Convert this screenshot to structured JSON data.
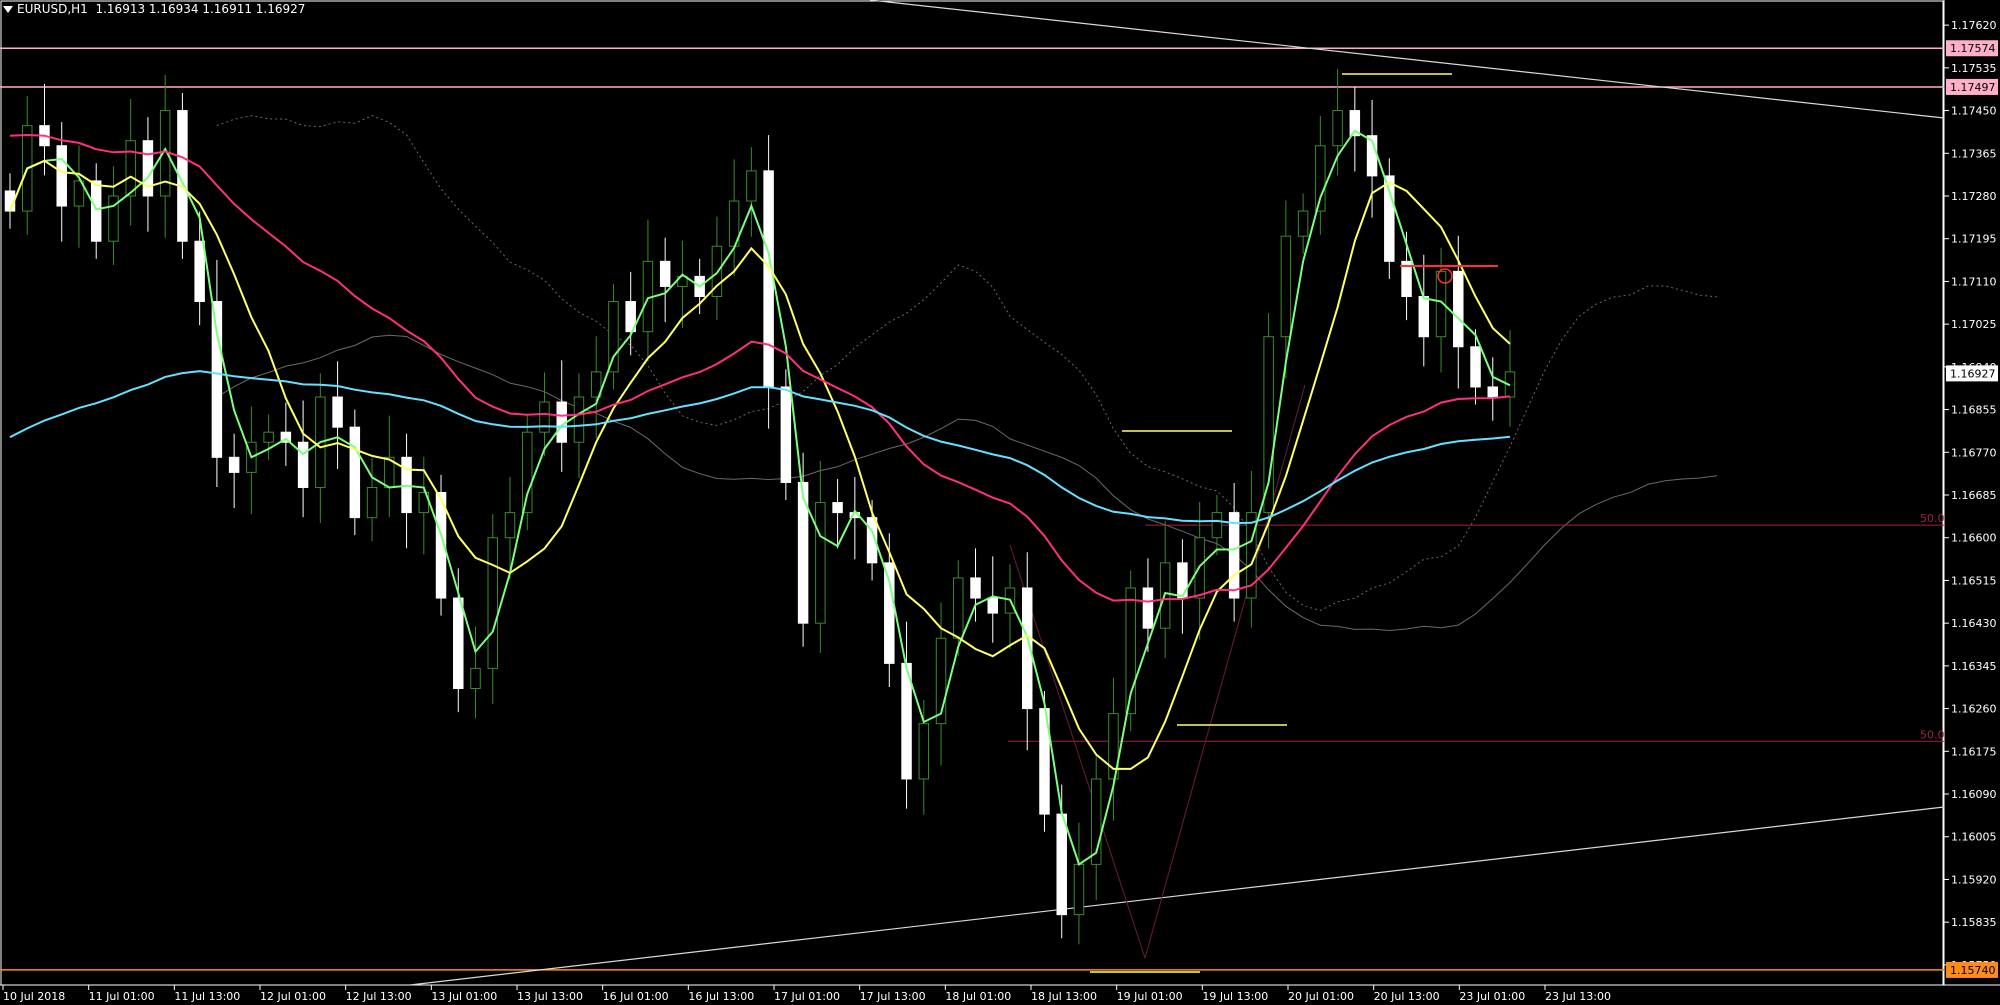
{
  "header": {
    "symbol": "EURUSD,H1",
    "ohlc": "1.16913 1.16934 1.16911 1.16927"
  },
  "colors": {
    "background": "#000000",
    "grid_frame": "#ffffff",
    "candle_bull": "#000000",
    "candle_bear": "#ffffff",
    "wick_bull": "#3a8a2a",
    "ma_fast": "#7cff7c",
    "ma_medium": "#ffff66",
    "ma_slow": "#ff2f7f",
    "ma_long": "#66e0ff",
    "ichimoku_cloud": "#6a6a6a",
    "resistance_line": "#ffb0c8",
    "support_line": "#ff8c1a",
    "fib_50": "#a0204a",
    "trend_line": "#d8d8e0",
    "marker_red": "#ff3030",
    "marker_yellow": "#ffff66"
  },
  "chart_data": {
    "type": "candlestick",
    "instrument": "EURUSD",
    "timeframe": "H1",
    "ylim": [
      1.1571,
      1.1767
    ],
    "y_ticks": [
      1.1762,
      1.17535,
      1.1745,
      1.17365,
      1.1728,
      1.17195,
      1.1711,
      1.17025,
      1.1694,
      1.16855,
      1.1677,
      1.16685,
      1.166,
      1.16515,
      1.1643,
      1.16345,
      1.1626,
      1.16175,
      1.1609,
      1.16005,
      1.1592,
      1.15835,
      1.1575
    ],
    "y_tick_labels": [
      "1.17620",
      "1.17535",
      "1.17450",
      "1.17365",
      "1.17280",
      "1.17195",
      "1.17110",
      "1.17025",
      "1.16940",
      "1.16855",
      "1.16770",
      "1.16685",
      "1.16600",
      "1.16515",
      "1.16430",
      "1.16345",
      "1.16260",
      "1.16175",
      "1.16090",
      "1.16005",
      "1.15920",
      "1.15835",
      "1.15750"
    ],
    "x_tick_labels": [
      "10 Jul 2018",
      "11 Jul 01:00",
      "11 Jul 13:00",
      "12 Jul 01:00",
      "12 Jul 13:00",
      "13 Jul 01:00",
      "13 Jul 13:00",
      "16 Jul 01:00",
      "16 Jul 13:00",
      "17 Jul 01:00",
      "17 Jul 13:00",
      "18 Jul 01:00",
      "18 Jul 13:00",
      "19 Jul 01:00",
      "19 Jul 13:00",
      "20 Jul 01:00",
      "20 Jul 13:00",
      "23 Jul 01:00",
      "23 Jul 13:00"
    ],
    "price_tags": [
      {
        "label": "1.17574",
        "value": 1.17574,
        "color": "#ffb0c8"
      },
      {
        "label": "1.17497",
        "value": 1.17497,
        "color": "#ffb0c8"
      },
      {
        "label": "1.16927",
        "value": 1.16927,
        "color": "#ffffff"
      },
      {
        "label": "1.15740",
        "value": 1.1574,
        "color": "#ff8c1a"
      }
    ],
    "fib_labels": [
      {
        "label": "50.0",
        "value": 1.16625
      },
      {
        "label": "50.0",
        "value": 1.16195
      }
    ],
    "close_series": [
      1.1725,
      1.1742,
      1.1738,
      1.1726,
      1.1731,
      1.1719,
      1.1728,
      1.1739,
      1.1728,
      1.1745,
      1.1719,
      1.1707,
      1.1676,
      1.1673,
      1.1679,
      1.1681,
      1.1679,
      1.167,
      1.1688,
      1.1682,
      1.1664,
      1.167,
      1.1676,
      1.1665,
      1.1669,
      1.1648,
      1.163,
      1.1634,
      1.166,
      1.1665,
      1.1681,
      1.1687,
      1.1679,
      1.1688,
      1.1693,
      1.1707,
      1.1701,
      1.1715,
      1.171,
      1.1712,
      1.1708,
      1.1718,
      1.1727,
      1.1733,
      1.169,
      1.1671,
      1.1643,
      1.1667,
      1.1665,
      1.1664,
      1.1655,
      1.1635,
      1.1612,
      1.1623,
      1.164,
      1.1652,
      1.1648,
      1.1645,
      1.165,
      1.1626,
      1.1605,
      1.1585,
      1.1595,
      1.1612,
      1.1625,
      1.165,
      1.1642,
      1.1655,
      1.1648,
      1.166,
      1.1665,
      1.1648,
      1.1665,
      1.17,
      1.172,
      1.1725,
      1.1738,
      1.1745,
      1.174,
      1.1732,
      1.1715,
      1.1708,
      1.17,
      1.1713,
      1.1698,
      1.169,
      1.1688,
      1.1693
    ]
  }
}
